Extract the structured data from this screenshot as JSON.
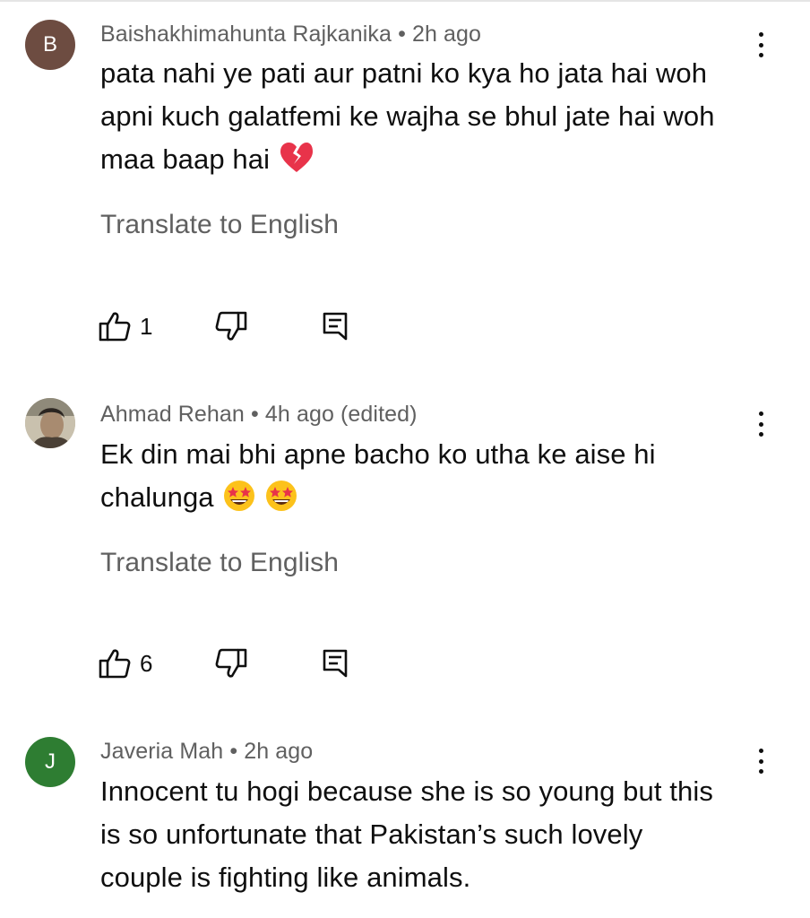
{
  "comments": [
    {
      "avatar_letter": "B",
      "avatar_color": "#6d4c41",
      "author": "Baishakhimahunta Rajkanika",
      "separator": "•",
      "time": "2h ago",
      "lines": [
        "pata nahi ye  pati aur patni ko kya ho jata hai woh",
        "apni kuch galatfemi ke wajha se bhul jate hai woh",
        "maa baap hai"
      ],
      "emoji": "broken-heart",
      "translate_label": "Translate to English",
      "likes": "1"
    },
    {
      "avatar_letter": "",
      "avatar_color": "#9e9e8a",
      "author": "Ahmad Rehan",
      "separator": "•",
      "time": "4h ago (edited)",
      "lines": [
        "Ek din mai bhi apne bacho ko utha ke aise hi",
        "chalunga"
      ],
      "emoji": "star-struck x2",
      "translate_label": "Translate to English",
      "likes": "6"
    },
    {
      "avatar_letter": "J",
      "avatar_color": "#2e7d32",
      "author": "Javeria Mah",
      "separator": "•",
      "time": "2h ago",
      "lines": [
        "Innocent tu hogi because she is so young but this",
        "is so unfortunate that Pakistan’s such lovely",
        "couple is fighting like animals."
      ]
    }
  ],
  "icons": {
    "like": "thumbs-up-icon",
    "dislike": "thumbs-down-icon",
    "reply": "reply-comment-icon",
    "more": "more-vert-icon"
  }
}
